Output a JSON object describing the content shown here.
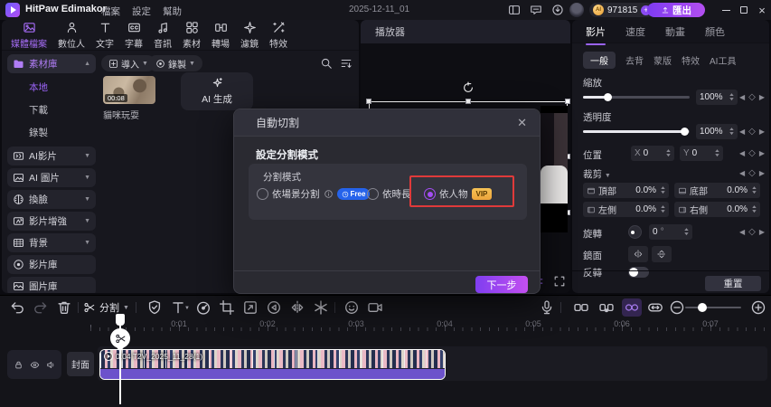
{
  "titlebar": {
    "app_title": "HitPaw Edimakor",
    "menus": [
      "檔案",
      "設定",
      "幫助"
    ],
    "date": "2025-12-11_01",
    "credits": "971815",
    "export_label": "匯出"
  },
  "ribbon": {
    "tabs": [
      {
        "label": "媒體檔案"
      },
      {
        "label": "數位人"
      },
      {
        "label": "文字"
      },
      {
        "label": "字幕"
      },
      {
        "label": "音訊"
      },
      {
        "label": "素材"
      },
      {
        "label": "轉場"
      },
      {
        "label": "濾鏡"
      },
      {
        "label": "特效"
      }
    ]
  },
  "sidebar": {
    "items": [
      {
        "label": "素材庫"
      },
      {
        "label": "本地"
      },
      {
        "label": "下載"
      },
      {
        "label": "錄製"
      },
      {
        "label": "AI影片"
      },
      {
        "label": "AI 圖片"
      },
      {
        "label": "換臉"
      },
      {
        "label": "影片增強"
      },
      {
        "label": "背景"
      },
      {
        "label": "影片庫"
      },
      {
        "label": "圖片庫"
      }
    ]
  },
  "media": {
    "import_label": "導入",
    "record_label": "錄製",
    "clip": {
      "duration": "00:08",
      "name": "貓咪玩耍"
    },
    "ai_generate_label": "AI 生成"
  },
  "player": {
    "title": "播放器"
  },
  "dialog": {
    "title": "自動切割",
    "section_title": "設定分割模式",
    "group_label": "分割模式",
    "options": [
      {
        "label": "依場景分割",
        "badge": "Free"
      },
      {
        "label": "依時長"
      },
      {
        "label": "依人物",
        "badge": "VIP"
      }
    ],
    "next_label": "下一步"
  },
  "inspector": {
    "tabs": [
      {
        "label": "影片"
      },
      {
        "label": "速度"
      },
      {
        "label": "動畫"
      },
      {
        "label": "顏色"
      }
    ],
    "subtabs": [
      {
        "label": "一般"
      },
      {
        "label": "去背"
      },
      {
        "label": "蒙版"
      },
      {
        "label": "特效"
      },
      {
        "label": "AI工具"
      }
    ],
    "scale": {
      "label": "縮放",
      "value": "100%"
    },
    "opacity": {
      "label": "透明度",
      "value": "100%"
    },
    "position": {
      "label": "位置",
      "x_label": "X",
      "x_value": "0",
      "y_label": "Y",
      "y_value": "0"
    },
    "crop": {
      "label": "裁剪",
      "fields": [
        {
          "label": "頂部",
          "value": "0.0%"
        },
        {
          "label": "底部",
          "value": "0.0%"
        },
        {
          "label": "左側",
          "value": "0.0%"
        },
        {
          "label": "右側",
          "value": "0.0%"
        }
      ]
    },
    "rotate": {
      "label": "旋轉",
      "value": "0",
      "unit": "°"
    },
    "mirror_label": "鏡面",
    "flip_label": "反轉",
    "reset_label": "重置"
  },
  "timeline": {
    "split_label": "分割",
    "cover_label": "封面",
    "clip_label": "0:04 T2V_2025_11_28(1)",
    "ruler_labels": [
      "0:01",
      "0:02",
      "0:03",
      "0:04",
      "0:05",
      "0:06",
      "0:07"
    ]
  },
  "colors": {
    "accent": "#9a63f5",
    "annotation_red": "#e03a3a",
    "clip_audio": "#6c52cb",
    "free_badge_blue": "#2563eb",
    "vip_badge_gold": "#eda43b"
  }
}
